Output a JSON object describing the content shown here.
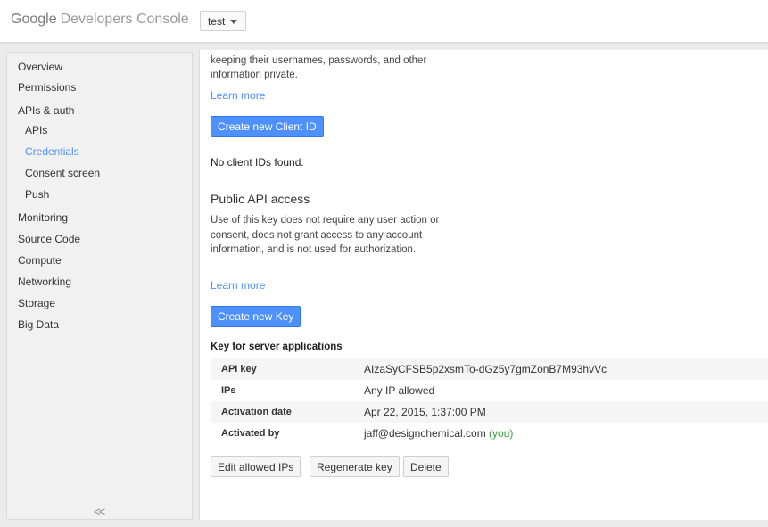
{
  "header": {
    "logo_google": "Google",
    "logo_product": "Developers Console",
    "project_value": "test"
  },
  "sidebar": {
    "items": [
      {
        "label": "Overview"
      },
      {
        "label": "Permissions"
      },
      {
        "label": "APIs & auth"
      },
      {
        "label": "APIs"
      },
      {
        "label": "Credentials"
      },
      {
        "label": "Consent screen"
      },
      {
        "label": "Push"
      },
      {
        "label": "Monitoring"
      },
      {
        "label": "Source Code"
      },
      {
        "label": "Compute"
      },
      {
        "label": "Networking"
      },
      {
        "label": "Storage"
      },
      {
        "label": "Big Data"
      }
    ],
    "active_item": "Credentials",
    "collapse_glyph": "<<"
  },
  "oauth": {
    "description_tail": "keeping their usernames, passwords, and other information private.",
    "learn_more": "Learn more",
    "create_button": "Create new Client ID",
    "empty_message": "No client IDs found."
  },
  "public_api": {
    "title": "Public API access",
    "description": "Use of this key does not require any user action or consent, does not grant access to any account information, and is not used for authorization.",
    "learn_more": "Learn more",
    "create_button": "Create new Key"
  },
  "server_key": {
    "title": "Key for server applications",
    "rows": [
      {
        "label": "API key",
        "value": "AIzaSyCFSB5p2xsmTo-dGz5y7gmZonB7M93hvVc"
      },
      {
        "label": "IPs",
        "value": "Any IP allowed"
      },
      {
        "label": "Activation date",
        "value": "Apr 22, 2015, 1:37:00 PM"
      },
      {
        "label": "Activated by",
        "value": "jaff@designchemical.com",
        "suffix": "(you)"
      }
    ],
    "actions": {
      "edit": "Edit allowed IPs",
      "regenerate": "Regenerate key",
      "delete": "Delete"
    }
  },
  "colors": {
    "accent": "#4d90fe",
    "you": "#3a9c3a"
  }
}
